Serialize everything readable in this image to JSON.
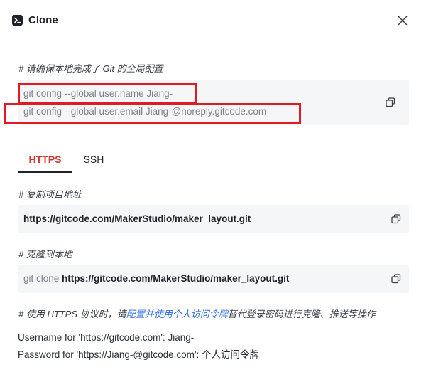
{
  "dialog": {
    "title": "Clone",
    "title_icon": "terminal-icon",
    "close_icon": "close-icon"
  },
  "config": {
    "label": "# 请确保本地完成了 Git 的全局配置",
    "line1": "git config --global user.name Jiang-",
    "line2": "git config --global user.email Jiang-@noreply.gitcode.com",
    "copy_icon": "copy-icon",
    "highlight_color": "#e31a23"
  },
  "tabs": [
    {
      "label": "HTTPS",
      "active": true
    },
    {
      "label": "SSH",
      "active": false
    }
  ],
  "accent_color": "#d4382f",
  "copy_url": {
    "label": "# 复制项目地址",
    "url": "https://gitcode.com/MakerStudio/maker_layout.git"
  },
  "clone_local": {
    "label": "# 克隆到本地",
    "prefix": "git clone ",
    "url": "https://gitcode.com/MakerStudio/maker_layout.git"
  },
  "tip": {
    "prefix": "# 使用 HTTPS 协议时，请",
    "link": "配置并使用个人访问令牌",
    "suffix": "替代登录密码进行克隆、推送等操作"
  },
  "credentials": {
    "username_line": "Username for 'https://gitcode.com': Jiang-",
    "password_line": "Password for 'https://Jiang-@gitcode.com': 个人访问令牌"
  }
}
